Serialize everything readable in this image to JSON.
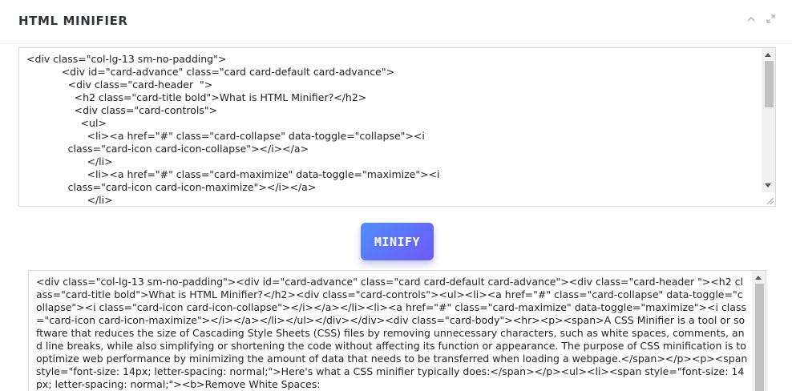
{
  "card": {
    "title": "HTML MINIFIER"
  },
  "controls": {
    "collapse_icon": "chevron-up-icon",
    "maximize_icon": "maximize-icon"
  },
  "input": {
    "value": "<div class=\"col-lg-13 sm-no-padding\">\n           <div id=\"card-advance\" class=\"card card-default card-advance\">\n             <div class=\"card-header  \">\n               <h2 class=\"card-title bold\">What is HTML Minifier?</h2>\n               <div class=\"card-controls\">\n                 <ul>\n                   <li><a href=\"#\" class=\"card-collapse\" data-toggle=\"collapse\"><i\n             class=\"card-icon card-icon-collapse\"></i></a>\n                   </li>\n                   <li><a href=\"#\" class=\"card-maximize\" data-toggle=\"maximize\"><i\n             class=\"card-icon card-icon-maximize\"></i></a>\n                   </li>"
  },
  "actions": {
    "minify_label": "MINIFY"
  },
  "output": {
    "value": "<div class=\"col-lg-13 sm-no-padding\"><div id=\"card-advance\" class=\"card card-default card-advance\"><div class=\"card-header \"><h2 class=\"card-title bold\">What is HTML Minifier?</h2><div class=\"card-controls\"><ul><li><a href=\"#\" class=\"card-collapse\" data-toggle=\"collapse\"><i class=\"card-icon card-icon-collapse\"></i></a></li><li><a href=\"#\" class=\"card-maximize\" data-toggle=\"maximize\"><i class=\"card-icon card-icon-maximize\"></i></a></li></ul></div></div><div class=\"card-body\"><hr><p><span>A CSS Minifier is a tool or software that reduces the size of Cascading Style Sheets (CSS) files by removing unnecessary characters, such as white spaces, comments, and line breaks, while also simplifying or shortening the code without affecting its function or appearance. The purpose of CSS minification is to optimize web performance by minimizing the amount of data that needs to be transferred when loading a webpage.</span></p><p><span style=\"font-size: 14px; letter-spacing: normal;\">Here's what a CSS minifier typically does:</span></p><ul><li><span style=\"font-size: 14px; letter-spacing: normal;\"><b>Remove White Spaces:"
  },
  "colors": {
    "button_start": "#4f8dfb",
    "button_end": "#6f59f5",
    "title": "#2f3437"
  }
}
